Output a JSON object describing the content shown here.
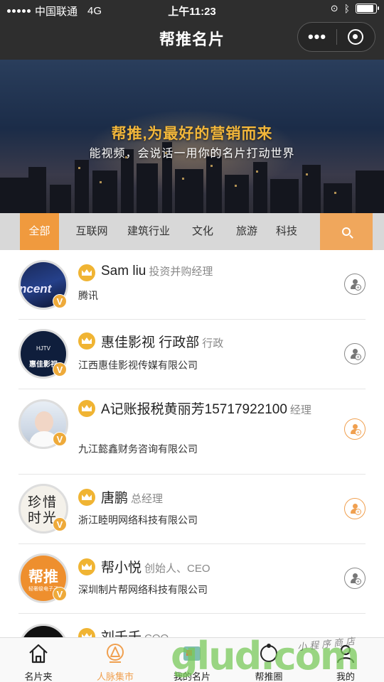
{
  "status": {
    "carrier": "中国联通",
    "network": "4G",
    "time": "上午11:23",
    "battery_level": 0.9
  },
  "nav": {
    "title": "帮推名片",
    "more_label": "•••"
  },
  "banner": {
    "headline": "帮推,为最好的营销而来",
    "subline": "能视频，会说话一用你的名片打动世界"
  },
  "categories": [
    {
      "label": "全部",
      "active": true
    },
    {
      "label": "互联网"
    },
    {
      "label": "建筑行业"
    },
    {
      "label": "文化"
    },
    {
      "label": "旅游"
    },
    {
      "label": "科技"
    }
  ],
  "cards": [
    {
      "name": "Sam liu",
      "role": "投资并购经理",
      "company": "腾讯",
      "badge": "V",
      "avatar_text": "ncent",
      "button": "gray"
    },
    {
      "name": "惠佳影视 行政部",
      "role": "行政",
      "company": "江西惠佳影视传媒有限公司",
      "badge": "V",
      "avatar_text": "惠佳影视",
      "avatar_sub": "HJTV",
      "button": "gray"
    },
    {
      "name": "A记账报税黄丽芳15717922100",
      "role": "经理",
      "company": "九江懿鑫财务咨询有限公司",
      "badge": "V",
      "avatar_text": "",
      "button": "orange"
    },
    {
      "name": "唐鹏",
      "role": "总经理",
      "company": "浙江睦明网络科技有限公司",
      "badge": "V",
      "avatar_text": "珍惜时光",
      "button": "orange"
    },
    {
      "name": "帮小悦",
      "role": "创始人、CEO",
      "company": "深圳制片帮网络科技有限公司",
      "badge": "V",
      "avatar_text": "帮推",
      "avatar_sub": "轻奢级电子子",
      "button": "gray"
    },
    {
      "name": "刘千千",
      "role": "COO",
      "company": "",
      "badge": "V",
      "avatar_text": "",
      "button": "gray"
    }
  ],
  "tabbar": [
    {
      "label": "名片夹",
      "icon": "home-icon"
    },
    {
      "label": "人脉集市",
      "icon": "location-icon",
      "active": true
    },
    {
      "label": "我的名片",
      "icon": "card-icon"
    },
    {
      "label": "帮推圈",
      "icon": "circle-icon"
    },
    {
      "label": "我的",
      "icon": "user-icon"
    }
  ],
  "watermark": {
    "text": "glud.com",
    "tagline": "小程序商店"
  },
  "colors": {
    "accent": "#f09a3e",
    "crown": "#f0b433",
    "navbar": "#2e2e2e"
  }
}
